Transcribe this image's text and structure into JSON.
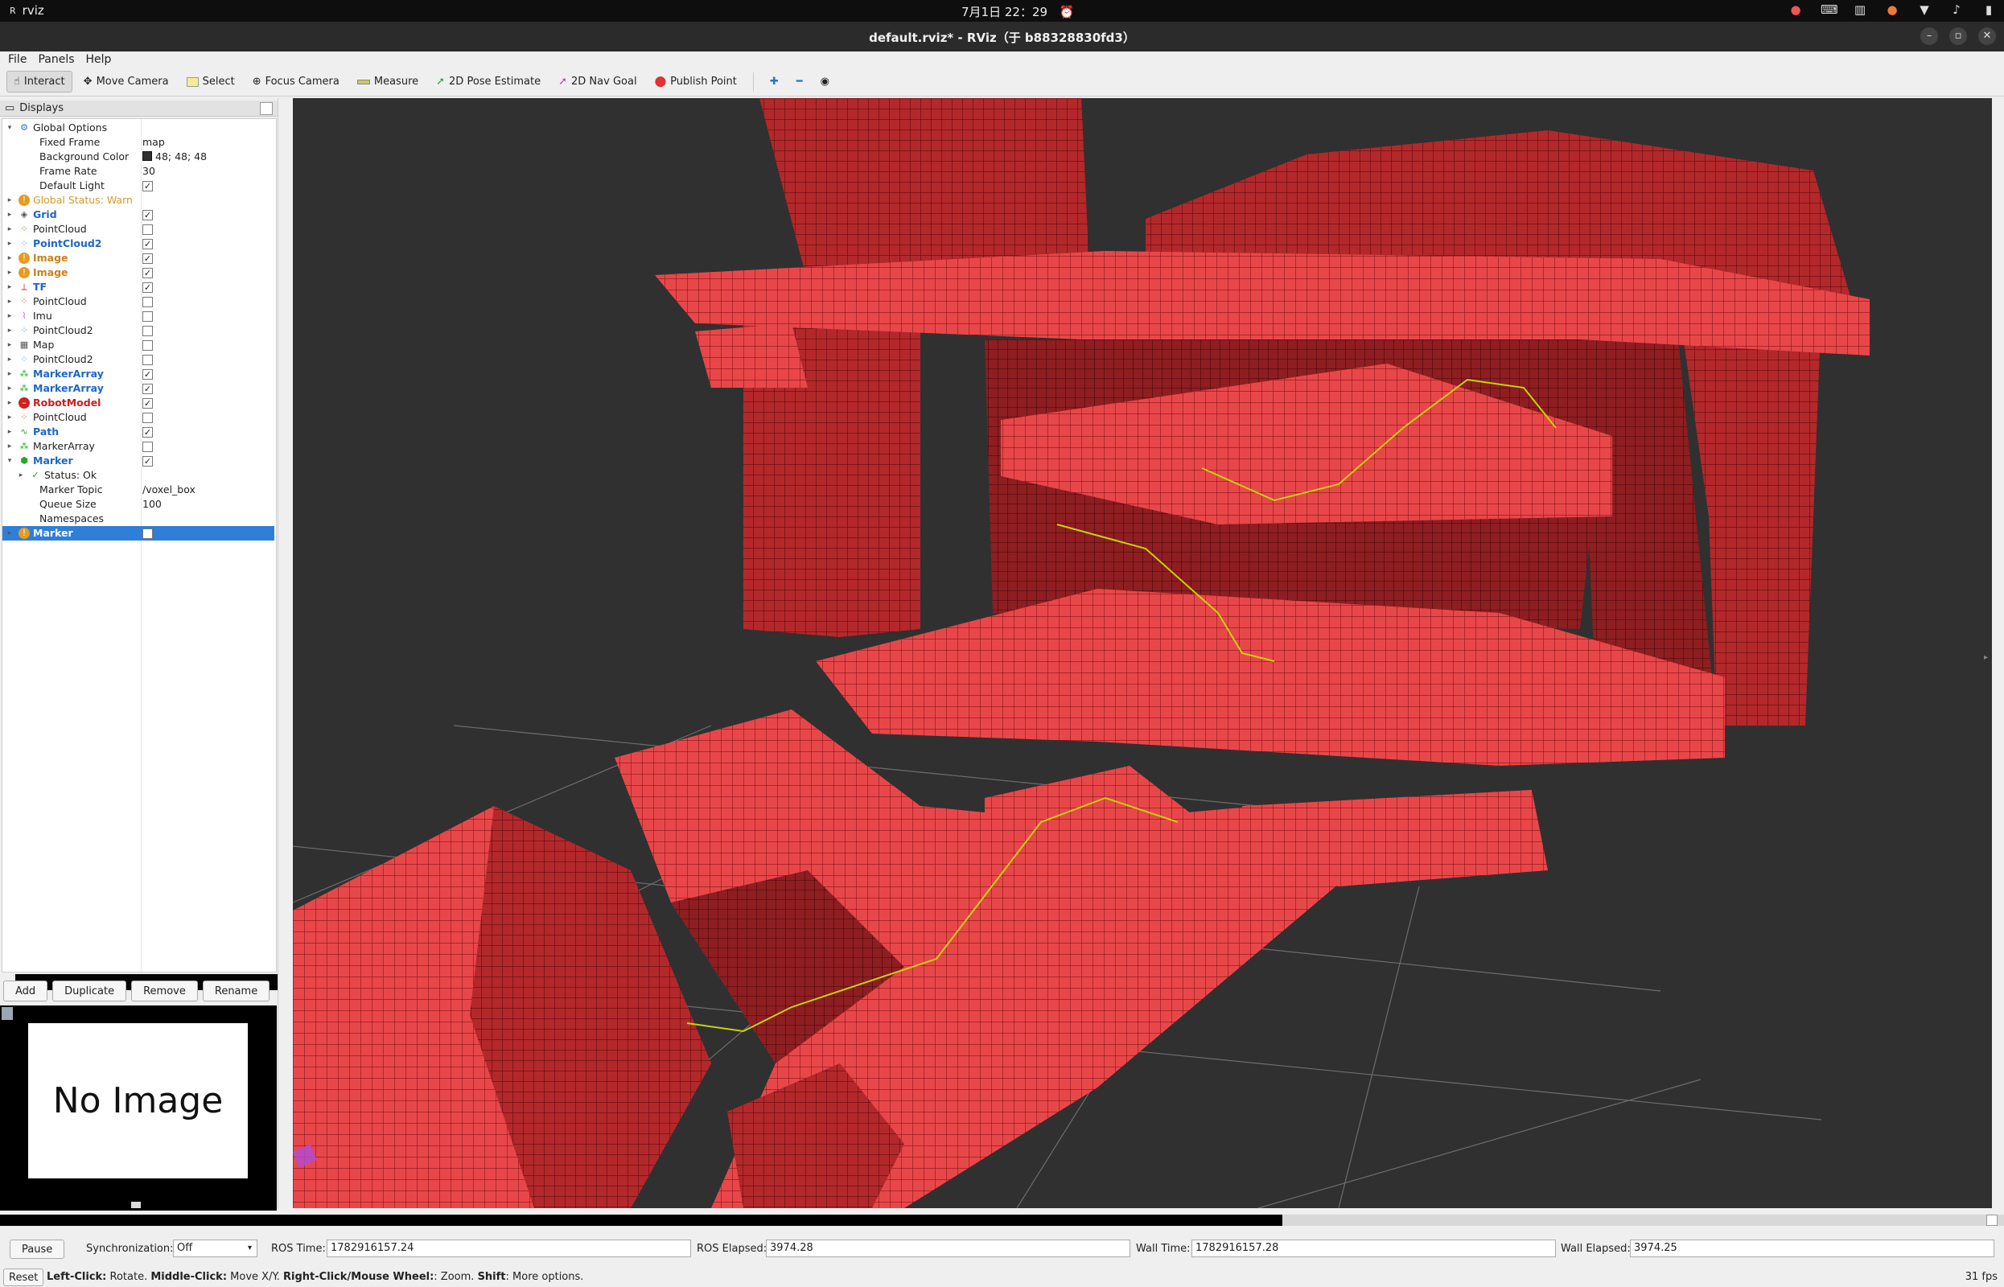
{
  "system_bar": {
    "app_name": "rviz",
    "clock": "7月1日 22：29"
  },
  "window": {
    "title": "default.rviz* - RViz（于 b88328830fd3）"
  },
  "menu": [
    "File",
    "Panels",
    "Help"
  ],
  "toolbar": {
    "tools": [
      {
        "label": "Interact",
        "icon": "hand-icon",
        "active": true
      },
      {
        "label": "Move Camera",
        "icon": "move-camera-icon"
      },
      {
        "label": "Select",
        "icon": "select-icon"
      },
      {
        "label": "Focus Camera",
        "icon": "focus-camera-icon"
      },
      {
        "label": "Measure",
        "icon": "measure-icon"
      },
      {
        "label": "2D Pose Estimate",
        "icon": "pose-estimate-icon"
      },
      {
        "label": "2D Nav Goal",
        "icon": "nav-goal-icon"
      },
      {
        "label": "Publish Point",
        "icon": "publish-point-icon"
      }
    ]
  },
  "displays": {
    "title": "Displays",
    "rows": [
      {
        "label": "Global Options",
        "indent": 0,
        "expanded": true,
        "icon": "gear-icon"
      },
      {
        "label": "Fixed Frame",
        "indent": 2,
        "value": "map"
      },
      {
        "label": "Background Color",
        "indent": 2,
        "value": "48; 48; 48",
        "swatch": "#303030"
      },
      {
        "label": "Frame Rate",
        "indent": 2,
        "value": "30"
      },
      {
        "label": "Default Light",
        "indent": 2,
        "checked": true
      },
      {
        "label": "Global Status: Warn",
        "indent": 0,
        "icon": "warning-icon",
        "style": "warntxt"
      },
      {
        "label": "Grid",
        "indent": 0,
        "icon": "grid-icon",
        "checked": true,
        "style": "blue"
      },
      {
        "label": "PointCloud",
        "indent": 0,
        "icon": "pointcloud-icon",
        "checked": false
      },
      {
        "label": "PointCloud2",
        "indent": 0,
        "icon": "pointcloud2-icon",
        "checked": true,
        "style": "blue"
      },
      {
        "label": "Image",
        "indent": 0,
        "icon": "warning-icon",
        "checked": true,
        "style": "orange"
      },
      {
        "label": "Image",
        "indent": 0,
        "icon": "warning-icon",
        "checked": true,
        "style": "orange"
      },
      {
        "label": "TF",
        "indent": 0,
        "icon": "tf-icon",
        "checked": true,
        "style": "blue"
      },
      {
        "label": "PointCloud",
        "indent": 0,
        "icon": "pointcloud-icon",
        "checked": false
      },
      {
        "label": "Imu",
        "indent": 0,
        "icon": "imu-icon",
        "checked": false
      },
      {
        "label": "PointCloud2",
        "indent": 0,
        "icon": "pointcloud2-icon",
        "checked": false
      },
      {
        "label": "Map",
        "indent": 0,
        "icon": "map-icon",
        "checked": false
      },
      {
        "label": "PointCloud2",
        "indent": 0,
        "icon": "pointcloud2-icon",
        "checked": false
      },
      {
        "label": "MarkerArray",
        "indent": 0,
        "icon": "markerarray-icon",
        "checked": true,
        "style": "blue"
      },
      {
        "label": "MarkerArray",
        "indent": 0,
        "icon": "markerarray-icon",
        "checked": true,
        "style": "blue"
      },
      {
        "label": "RobotModel",
        "indent": 0,
        "icon": "error-icon",
        "checked": true,
        "style": "red"
      },
      {
        "label": "PointCloud",
        "indent": 0,
        "icon": "pointcloud-icon",
        "checked": false
      },
      {
        "label": "Path",
        "indent": 0,
        "icon": "path-icon",
        "checked": true,
        "style": "blue"
      },
      {
        "label": "MarkerArray",
        "indent": 0,
        "icon": "markerarray-icon",
        "checked": false
      },
      {
        "label": "Marker",
        "indent": 0,
        "icon": "marker-icon",
        "checked": true,
        "expanded": true,
        "style": "blue"
      },
      {
        "label": "Status: Ok",
        "indent": 1,
        "icon": "check-icon"
      },
      {
        "label": "Marker Topic",
        "indent": 2,
        "value": "/voxel_box"
      },
      {
        "label": "Queue Size",
        "indent": 2,
        "value": "100"
      },
      {
        "label": "Namespaces",
        "indent": 2
      },
      {
        "label": "Marker",
        "indent": 0,
        "icon": "warning-icon",
        "checked": true,
        "selected": true,
        "style": "blue"
      }
    ],
    "buttons": [
      "Add",
      "Duplicate",
      "Remove",
      "Rename"
    ]
  },
  "image_panel": {
    "text": "No Image"
  },
  "colors": {
    "voxel": "#d93b3e",
    "voxel_top": "#f04b4e",
    "voxel_edge": "#7a1012",
    "path": "#c8d20a",
    "background": "#303030",
    "grid": "#8a8a8a",
    "selection": "#2f7ed8"
  },
  "progress": {
    "fraction": 0.64
  },
  "time": {
    "pause_label": "Pause",
    "sync_label": "Synchronization:",
    "sync_value": "Off",
    "ros_time_label": "ROS Time:",
    "ros_time": "1782916157.24",
    "ros_elapsed_label": "ROS Elapsed:",
    "ros_elapsed": "3974.28",
    "wall_time_label": "Wall Time:",
    "wall_time": "1782916157.28",
    "wall_elapsed_label": "Wall Elapsed:",
    "wall_elapsed": "3974.25"
  },
  "status": {
    "reset_label": "Reset",
    "hint_parts": [
      {
        "text": "Left-Click:",
        "bold": true
      },
      {
        "text": " Rotate. ",
        "bold": false
      },
      {
        "text": "Middle-Click:",
        "bold": true
      },
      {
        "text": " Move X/Y. ",
        "bold": false
      },
      {
        "text": "Right-Click/Mouse Wheel:",
        "bold": true
      },
      {
        "text": ": Zoom. ",
        "bold": false
      },
      {
        "text": "Shift",
        "bold": true
      },
      {
        "text": ": More options.",
        "bold": false
      }
    ],
    "fps": "31 fps"
  }
}
